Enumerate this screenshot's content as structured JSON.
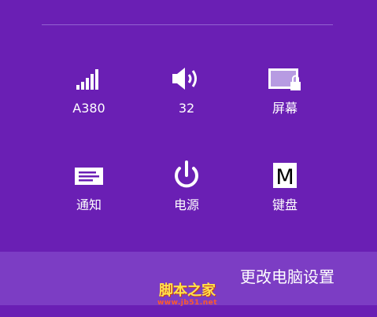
{
  "colors": {
    "background": "#6a1fb4",
    "footer": "#7c3dc4",
    "icon": "#ffffff",
    "screen_icon_fill": "#b79be2"
  },
  "tiles": [
    {
      "label": "A380",
      "icon": "signal-strength-icon"
    },
    {
      "label": "32",
      "icon": "volume-icon"
    },
    {
      "label": "屏幕",
      "icon": "screen-icon"
    },
    {
      "label": "通知",
      "icon": "notifications-icon"
    },
    {
      "label": "电源",
      "icon": "power-icon"
    },
    {
      "label": "键盘",
      "icon": "keyboard-icon"
    }
  ],
  "keyboard_icon_letter": "M",
  "footer": {
    "settings_label": "更改电脑设置"
  },
  "watermark": {
    "title": "脚本之家",
    "url": "www.jb51.net"
  }
}
